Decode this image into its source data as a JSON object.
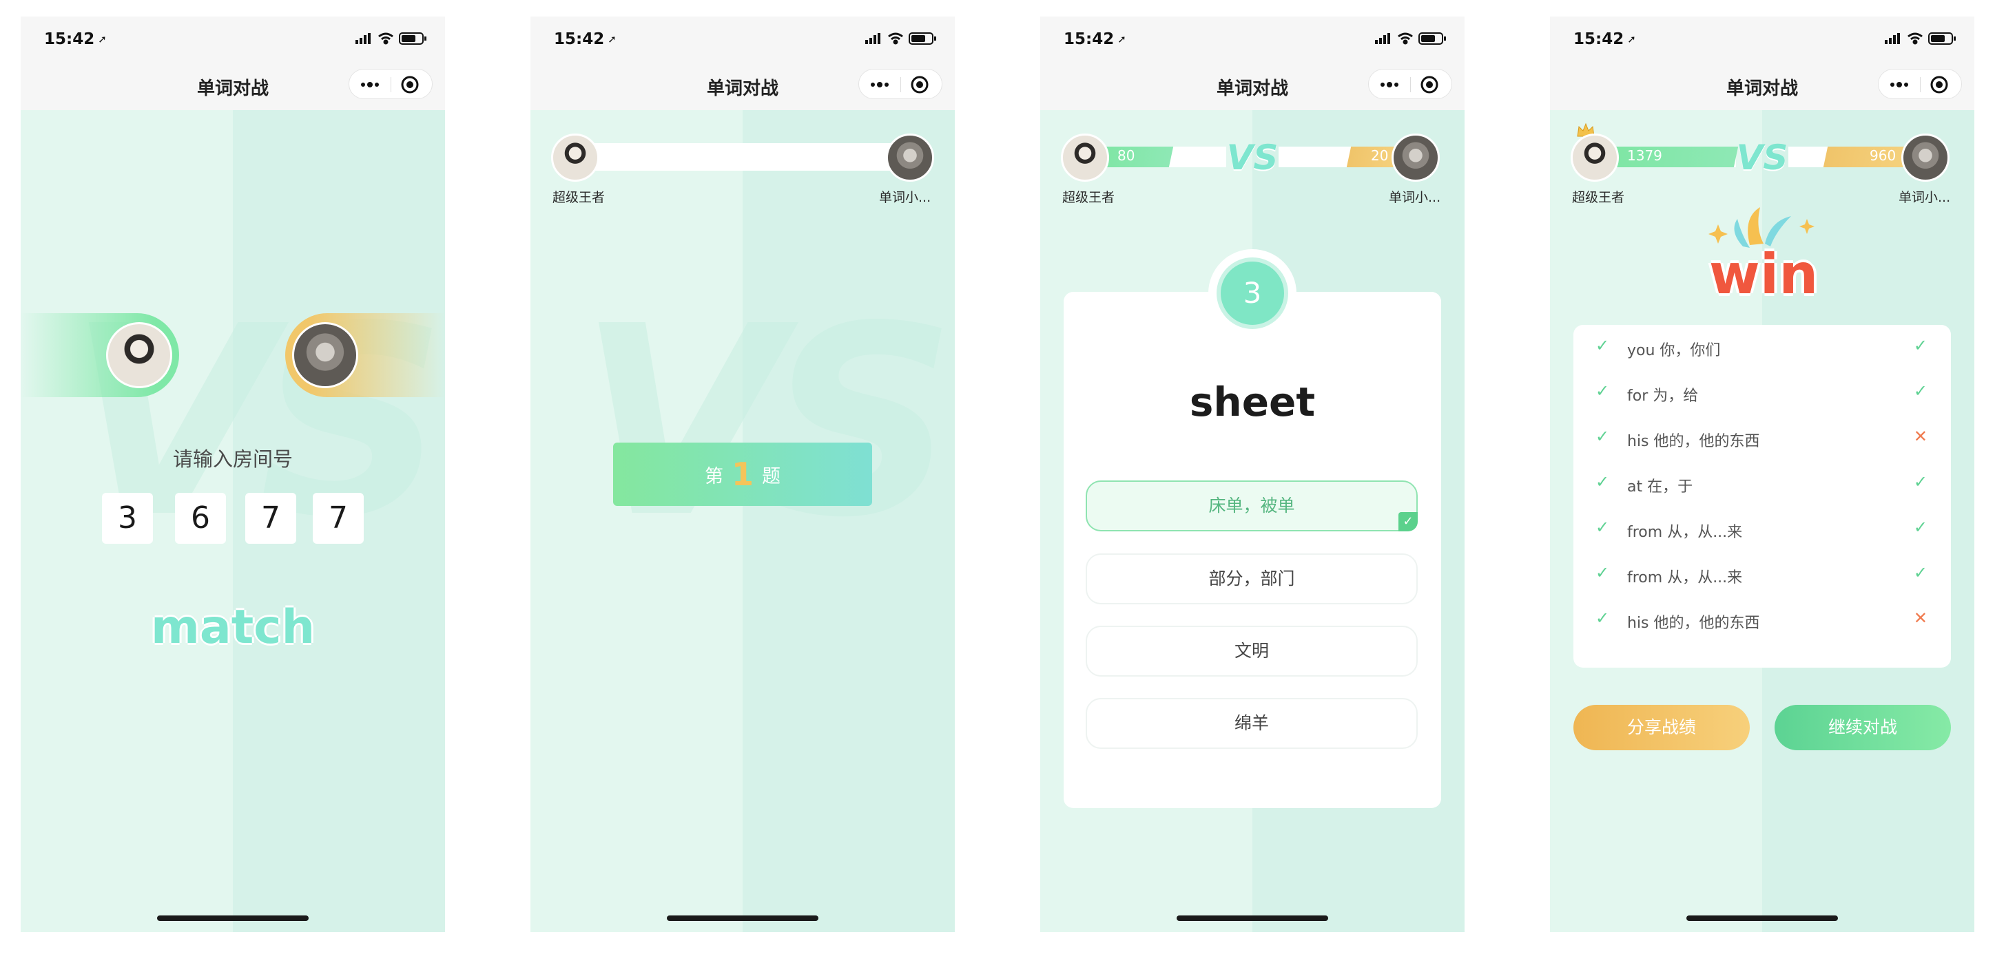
{
  "status": {
    "time": "15:42"
  },
  "nav": {
    "title": "单词对战"
  },
  "players": {
    "left_name": "超级王者",
    "right_name": "单词小..."
  },
  "screen1": {
    "room_label": "请输入房间号",
    "digits": [
      "3",
      "6",
      "7",
      "7"
    ],
    "match_label": "match"
  },
  "screen2": {
    "round_prefix": "第",
    "round_number": "1",
    "round_suffix": "题"
  },
  "screen3": {
    "left_score": "80",
    "right_score": "20",
    "vs_label": "VS",
    "countdown": "3",
    "word": "sheet",
    "options": [
      "床单，被单",
      "部分，部门",
      "文明",
      "绵羊"
    ],
    "selected_option": 0
  },
  "screen4": {
    "left_score": "1379",
    "right_score": "960",
    "vs_label": "VS",
    "win_label": "win",
    "results": [
      {
        "text": "you  你，你们",
        "correct": true
      },
      {
        "text": "for  为，给",
        "correct": true
      },
      {
        "text": "his  他的，他的东西",
        "correct": false
      },
      {
        "text": "at  在，于",
        "correct": true
      },
      {
        "text": "from  从，从...来",
        "correct": true
      },
      {
        "text": "from  从，从...来",
        "correct": true
      },
      {
        "text": "his  他的，他的东西",
        "correct": false
      }
    ],
    "share_label": "分享战绩",
    "continue_label": "继续对战"
  },
  "icons": {
    "location": "location-arrow-icon",
    "signal": "signal-icon",
    "wifi": "wifi-icon",
    "battery": "battery-icon",
    "more": "more-dots-icon",
    "target": "target-icon",
    "check": "check-icon",
    "cross": "cross-icon",
    "crown": "crown-icon"
  },
  "colors": {
    "mint_bg": "#e3f7ef",
    "mint_bg_right": "#d6f2e9",
    "green_accent": "#5fd293",
    "orange_accent": "#efb653",
    "wrong_red": "#f07a4e",
    "teal_text": "#7ee6cf"
  }
}
